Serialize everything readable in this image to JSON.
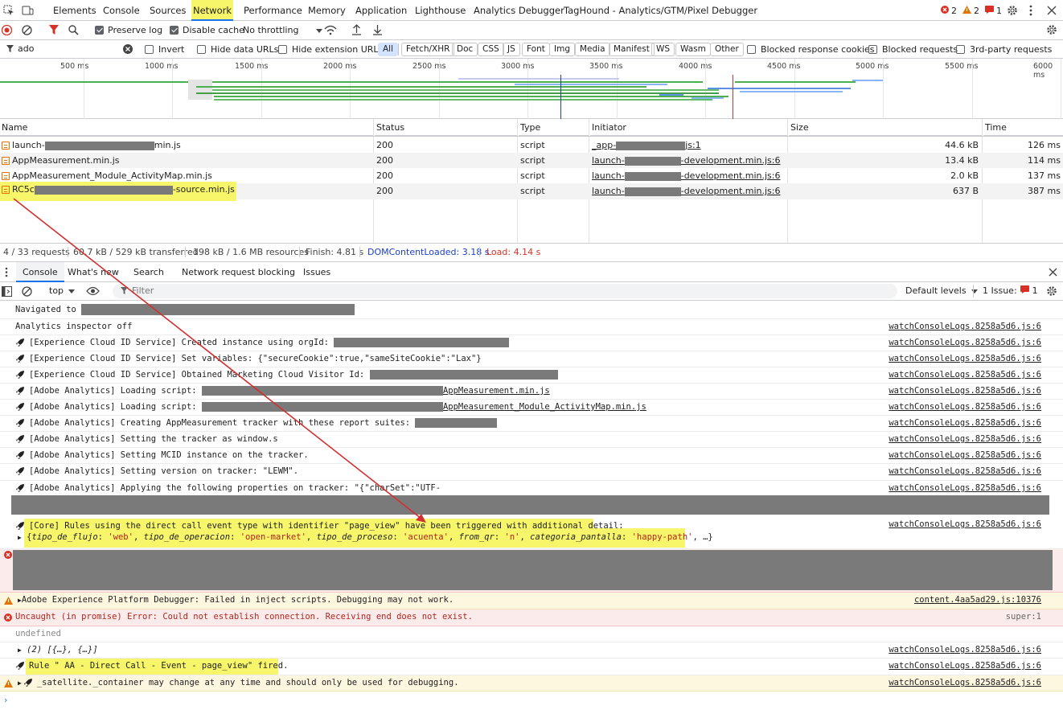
{
  "tabs": [
    "Elements",
    "Console",
    "Sources",
    "Network",
    "Performance",
    "Memory",
    "Application",
    "Lighthouse",
    "Analytics Debugger",
    "TagHound - Analytics/GTM/Pixel Debugger"
  ],
  "counts": {
    "errors": "2",
    "warnings": "2",
    "issues": "1"
  },
  "toolbar": {
    "preserve_log": "Preserve log",
    "disable_cache": "Disable cache",
    "throttling": "No throttling"
  },
  "filter": {
    "value": "ado",
    "invert": "Invert",
    "hide_data_urls": "Hide data URLs",
    "hide_ext_urls": "Hide extension URLs",
    "types": [
      "All",
      "Fetch/XHR",
      "Doc",
      "CSS",
      "JS",
      "Font",
      "Img",
      "Media",
      "Manifest",
      "WS",
      "Wasm",
      "Other"
    ],
    "blocked_cookies": "Blocked response cookies",
    "blocked_requests": "Blocked requests",
    "third_party": "3rd-party requests"
  },
  "timeline": {
    "ticks": [
      "500 ms",
      "1000 ms",
      "1500 ms",
      "2000 ms",
      "2500 ms",
      "3000 ms",
      "3500 ms",
      "4000 ms",
      "4500 ms",
      "5000 ms",
      "5500 ms",
      "6000 ms"
    ]
  },
  "table": {
    "headers": {
      "name": "Name",
      "status": "Status",
      "type": "Type",
      "initiator": "Initiator",
      "size": "Size",
      "time": "Time"
    },
    "rows": [
      {
        "name_pre": "launch-",
        "name_post": "min.js",
        "status": "200",
        "type": "script",
        "init_pre": "_app-",
        "init_post": "js:1",
        "size": "44.6 kB",
        "time": "126 ms"
      },
      {
        "name_pre": "AppMeasurement.min.js",
        "name_post": "",
        "status": "200",
        "type": "script",
        "init_pre": "launch-",
        "init_post": "-development.min.js:6",
        "size": "13.4 kB",
        "time": "114 ms"
      },
      {
        "name_pre": "AppMeasurement_Module_ActivityMap.min.js",
        "name_post": "",
        "status": "200",
        "type": "script",
        "init_pre": "launch-",
        "init_post": "-development.min.js:6",
        "size": "2.0 kB",
        "time": "137 ms"
      },
      {
        "name_pre": "RC5c",
        "name_post": "-source.min.js",
        "status": "200",
        "type": "script",
        "init_pre": "launch-",
        "init_post": "-development.min.js:6",
        "size": "637 B",
        "time": "387 ms"
      }
    ]
  },
  "summary": {
    "requests": "4 / 33 requests",
    "transferred": "60.7 kB / 529 kB transferred",
    "resources": "198 kB / 1.6 MB resources",
    "finish": "Finish: 4.81 s",
    "dcl": "DOMContentLoaded: 3.18 s",
    "load": "Load: 4.14 s"
  },
  "drawer": {
    "tabs": [
      "Console",
      "What's new",
      "Search",
      "Network request blocking",
      "Issues"
    ]
  },
  "console_toolbar": {
    "context": "top",
    "filter_placeholder": "Filter",
    "levels": "Default levels",
    "issues": "1 Issue:",
    "issues_count": "1"
  },
  "console": {
    "navigated": "Navigated to",
    "inspector_off": "Analytics inspector off",
    "src_watch": "watchConsoleLogs.8258a5d6.js:6",
    "lines": [
      "[Experience Cloud ID Service] Created instance using orgId:",
      "[Experience Cloud ID Service] Set variables: {\"secureCookie\":true,\"sameSiteCookie\":\"Lax\"}",
      "[Experience Cloud ID Service] Obtained Marketing Cloud Visitor Id:",
      "[Adobe Analytics] Loading script:",
      "[Adobe Analytics] Loading script:",
      "[Adobe Analytics] Creating AppMeasurement tracker with these report suites:",
      "[Adobe Analytics] Setting the tracker as window.s",
      "[Adobe Analytics] Setting MCID instance on the tracker.",
      "[Adobe Analytics] Setting version on tracker: \"LEWM\".",
      "[Adobe Analytics] Applying the following properties on tracker: \"{\"charSet\":\"UTF-"
    ],
    "loading_suffix_1": "AppMeasurement.min.js",
    "loading_suffix_2": "AppMeasurement_Module_ActivityMap.min.js",
    "core_rule": "[Core] Rules using the direct call event type with identifier \"page_view\" have been triggered with additional detail:",
    "core_obj": {
      "k1": "tipo_de_flujo",
      "v1": "'web'",
      "k2": "tipo_de_operacion",
      "v2": "'open-market'",
      "k3": "tipo_de_proceso",
      "v3": "'acuenta'",
      "k4": "from_qr",
      "v4": "'n'",
      "k5": "categoria_pantalla",
      "v5": "'happy-path'",
      "tail": ", …}"
    },
    "aep_warn": "Adobe Experience Platform Debugger: Failed in inject scripts. Debugging may not work.",
    "aep_src": "content.4aa5ad29.js:10376",
    "uncaught": "Uncaught (in promise) Error: Could not establish connection. Receiving end does not exist.",
    "uncaught_src": "super:1",
    "undefined": "undefined",
    "array": "(2) [{…}, {…}]",
    "rule_fired": "Rule \" AA - Direct Call - Event - page_view\" fired.",
    "satellite": "_satellite._container may change at any time and should only be used for debugging."
  },
  "colors": {
    "accent": "#1a73e8",
    "error": "#d93025",
    "warning": "#e37400",
    "highlight": "#f7f56a",
    "arrow": "#d32f2f",
    "redaction": "#7a7a7a"
  }
}
